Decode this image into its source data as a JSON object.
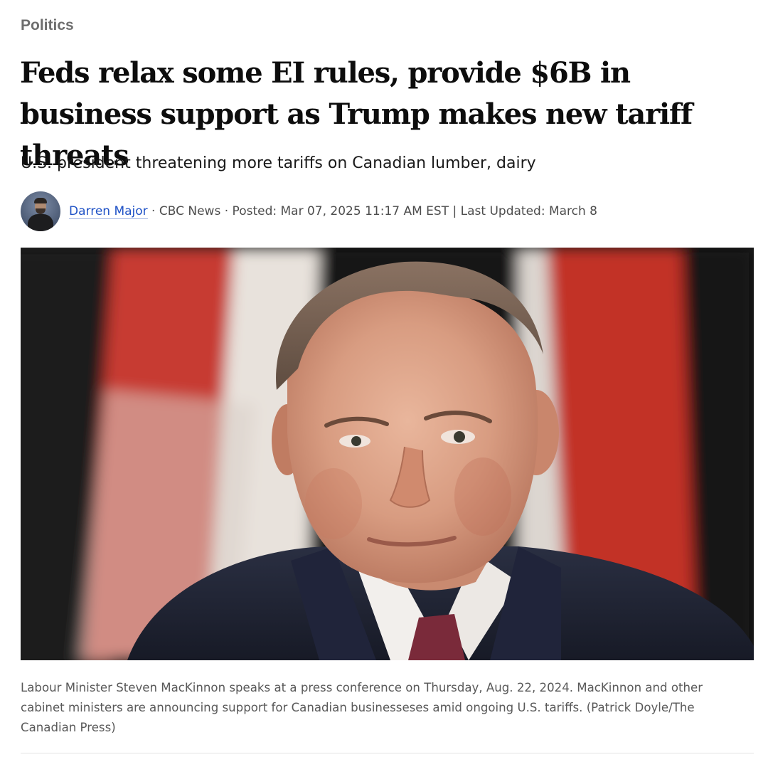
{
  "section": {
    "label": "Politics"
  },
  "article": {
    "headline": "Feds relax some EI rules, provide $6B in business support as Trump makes new tariff threats",
    "dek": "U.S. president threatening more tariffs on Canadian lumber, dairy",
    "byline": {
      "author": "Darren Major",
      "separator_1": " · ",
      "outlet": "CBC News",
      "separator_2": " · ",
      "posted": "Posted: Mar 07, 2025 11:17 AM EST",
      "separator_3": " | ",
      "updated": "Last Updated: March 8"
    },
    "caption": "Labour Minister Steven MacKinnon speaks at a press conference on Thursday, Aug. 22, 2024. MacKinnon and other cabinet ministers are announcing support for Canadian businesseses amid ongoing U.S. tariffs. (Patrick Doyle/The Canadian Press)"
  },
  "colors": {
    "author_link": "#1f52c6",
    "flag_red": "#c8362e",
    "suit": "#1e2233"
  },
  "icons": {
    "avatar": "author-avatar-photo"
  }
}
